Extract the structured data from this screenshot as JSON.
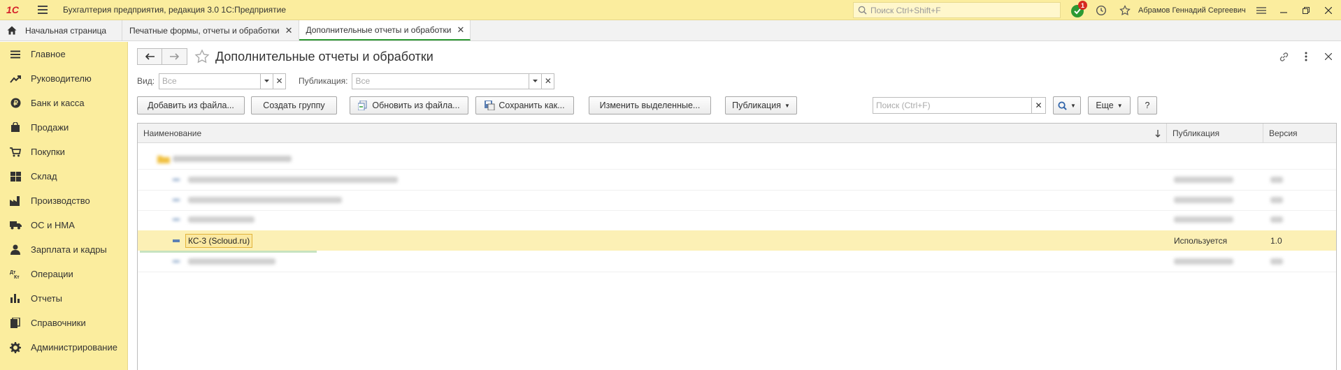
{
  "app": {
    "title": "Бухгалтерия предприятия, редакция 3.0 1С:Предприятие",
    "logo_text": "1С",
    "search_placeholder": "Поиск Ctrl+Shift+F",
    "notifications_count": "1",
    "user_name": "Абрамов Геннадий Сергеевич"
  },
  "tabs": {
    "home": "Начальная страница",
    "items": [
      {
        "label": "Печатные формы, отчеты и обработки",
        "active": false
      },
      {
        "label": "Дополнительные отчеты и обработки",
        "active": true
      }
    ]
  },
  "sidebar": {
    "items": [
      {
        "label": "Главное",
        "icon": "menu-icon"
      },
      {
        "label": "Руководителю",
        "icon": "trend-icon"
      },
      {
        "label": "Банк и касса",
        "icon": "ruble-icon"
      },
      {
        "label": "Продажи",
        "icon": "bag-icon"
      },
      {
        "label": "Покупки",
        "icon": "cart-icon"
      },
      {
        "label": "Склад",
        "icon": "warehouse-icon"
      },
      {
        "label": "Производство",
        "icon": "factory-icon"
      },
      {
        "label": "ОС и НМА",
        "icon": "truck-icon"
      },
      {
        "label": "Зарплата и кадры",
        "icon": "person-icon"
      },
      {
        "label": "Операции",
        "icon": "dt-kt-icon"
      },
      {
        "label": "Отчеты",
        "icon": "bar-chart-icon"
      },
      {
        "label": "Справочники",
        "icon": "books-icon"
      },
      {
        "label": "Администрирование",
        "icon": "gear-icon"
      }
    ]
  },
  "form": {
    "title": "Дополнительные отчеты и обработки",
    "filters": {
      "vid_label": "Вид:",
      "vid_value": "Все",
      "pub_label": "Публикация:",
      "pub_value": "Все"
    },
    "buttons": {
      "add_from_file": "Добавить из файла...",
      "create_group": "Создать группу",
      "update_from_file": "Обновить из файла...",
      "save_as": "Сохранить как...",
      "change_selected": "Изменить выделенные...",
      "publication": "Публикация",
      "more": "Еще",
      "help": "?"
    },
    "search_placeholder": "Поиск (Ctrl+F)"
  },
  "table": {
    "columns": [
      "Наименование",
      "Публикация",
      "Версия"
    ],
    "selected_row": {
      "name": "КС-3 (Scloud.ru)",
      "publication": "Используется",
      "version": "1.0"
    }
  }
}
